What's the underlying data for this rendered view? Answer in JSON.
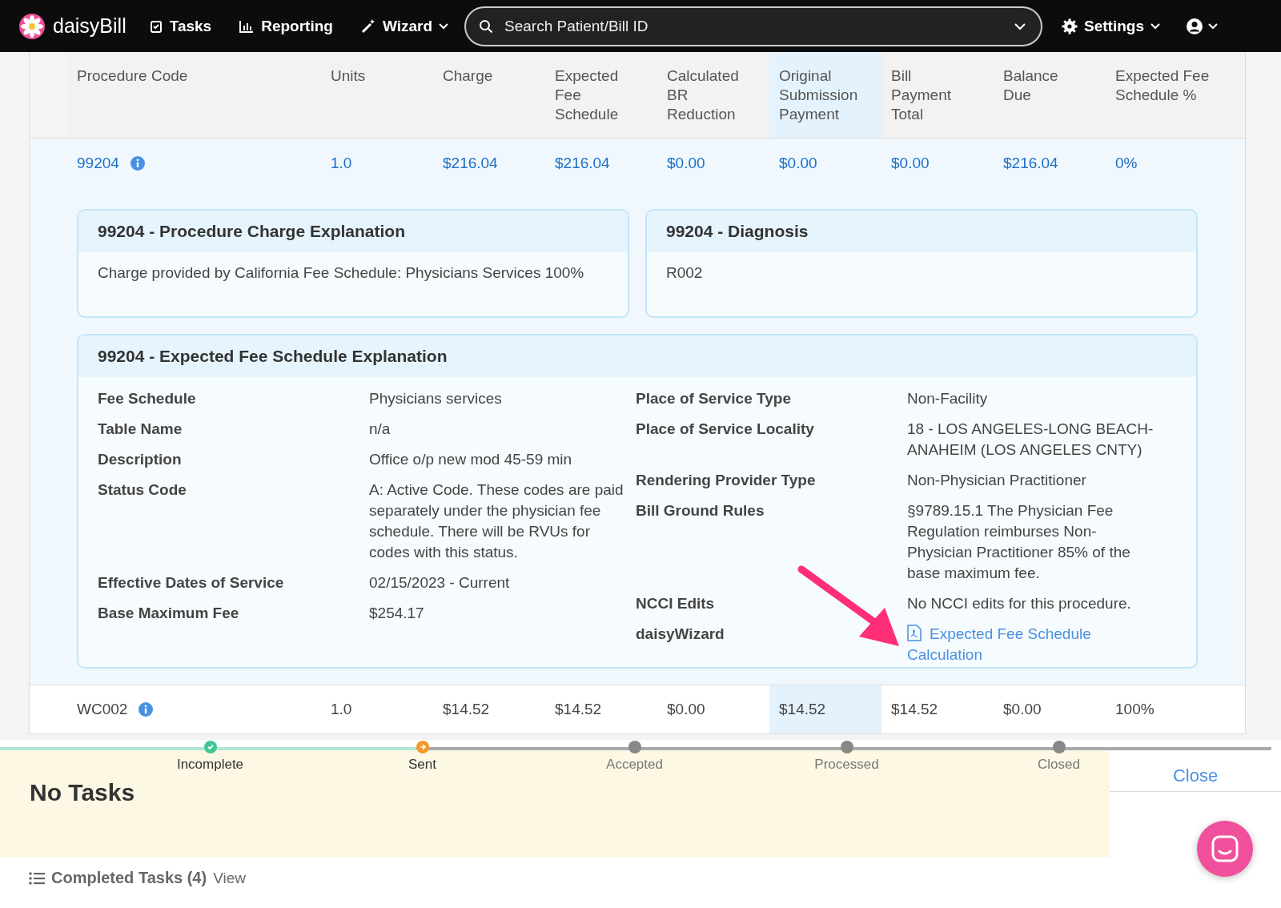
{
  "nav": {
    "logo": "daisyBill",
    "items": [
      {
        "label": "Tasks",
        "kind": "tasks"
      },
      {
        "label": "Reporting",
        "kind": "reporting"
      },
      {
        "label": "Wizard",
        "kind": "wizard"
      }
    ],
    "search": {
      "placeholder": "Search Patient/Bill ID"
    },
    "settings": "Settings"
  },
  "table": {
    "columns": [
      {
        "label": "Procedure Code",
        "highlighted": false
      },
      {
        "label": "Units",
        "highlighted": false
      },
      {
        "label": "Charge",
        "highlighted": false
      },
      {
        "label": "Expected Fee Schedule",
        "highlighted": false
      },
      {
        "label": "Calculated BR Reduction",
        "highlighted": false
      },
      {
        "label": "Original Submission Payment",
        "highlighted": true
      },
      {
        "label": "Bill Payment Total",
        "highlighted": false
      },
      {
        "label": "Balance Due",
        "highlighted": false
      },
      {
        "label": "Expected Fee Schedule %",
        "highlighted": false
      }
    ],
    "rows": [
      {
        "expanded": true,
        "cells": [
          "99204",
          "1.0",
          "$216.04",
          "$216.04",
          "$0.00",
          "$0.00",
          "$0.00",
          "$216.04",
          "0%"
        ],
        "panels": [
          {
            "title": "99204 - Procedure Charge Explanation",
            "body": "Charge provided by California Fee Schedule: Physicians Services 100%"
          },
          {
            "title": "99204 - Diagnosis",
            "body": "R002"
          }
        ],
        "explanation": {
          "title": "99204 - Expected Fee Schedule Explanation",
          "left": [
            {
              "label": "Fee Schedule",
              "value": "Physicians services",
              "kind": "text"
            },
            {
              "label": "Table Name",
              "value": "n/a",
              "kind": "text"
            },
            {
              "label": "Description",
              "value": "Office o/p new mod 45-59 min",
              "kind": "text"
            },
            {
              "label": "Status Code",
              "value": "A: Active Code. These codes are paid separately under the physician fee schedule. There will be RVUs for codes with this status.",
              "kind": "text"
            },
            {
              "label": "Effective Dates of Service",
              "value": "02/15/2023 - Current",
              "kind": "text"
            },
            {
              "label": "Base Maximum Fee",
              "value": "$254.17",
              "kind": "text"
            }
          ],
          "right": [
            {
              "label": "Place of Service Type",
              "value": "Non-Facility",
              "kind": "text"
            },
            {
              "label": "Place of Service Locality",
              "value": "18 - LOS ANGELES-LONG BEACH-ANAHEIM (LOS ANGELES CNTY)",
              "kind": "text"
            },
            {
              "label": "Rendering Provider Type",
              "value": "Non-Physician Practitioner",
              "kind": "text"
            },
            {
              "label": "Bill Ground Rules",
              "value": "§9789.15.1 The Physician Fee Regulation reimburses Non-Physician Practitioner 85% of the base maximum fee.",
              "kind": "text"
            },
            {
              "label": "NCCI Edits",
              "value": "No NCCI edits for this procedure.",
              "kind": "text"
            },
            {
              "label": "daisyWizard",
              "value": "Expected Fee Schedule Calculation",
              "kind": "pdf-link"
            }
          ]
        }
      },
      {
        "expanded": false,
        "cells": [
          "WC002",
          "1.0",
          "$14.52",
          "$14.52",
          "$0.00",
          "$14.52",
          "$14.52",
          "$0.00",
          "100%"
        ]
      }
    ]
  },
  "progress": {
    "steps": [
      {
        "label": "Incomplete",
        "done": true,
        "current": false
      },
      {
        "label": "Sent",
        "done": false,
        "current": true
      },
      {
        "label": "Accepted",
        "done": false,
        "current": false
      },
      {
        "label": "Processed",
        "done": false,
        "current": false
      },
      {
        "label": "Closed",
        "done": false,
        "current": false
      }
    ]
  },
  "tasks": {
    "title": "No Tasks",
    "close": "Close",
    "completed": "Completed Tasks (4)",
    "view": "View"
  }
}
